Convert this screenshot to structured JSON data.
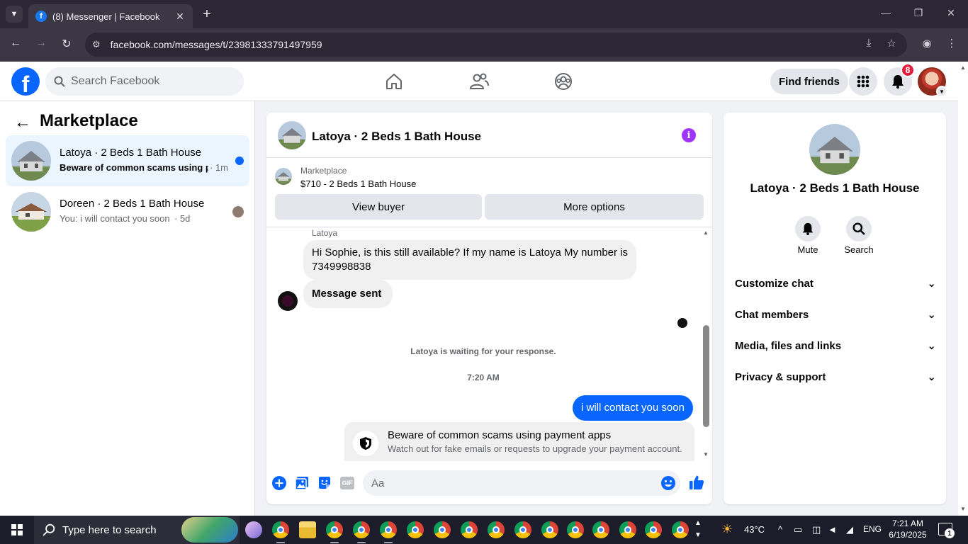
{
  "browser": {
    "tab_title": "(8) Messenger | Facebook",
    "url": "facebook.com/messages/t/23981333791497959"
  },
  "header": {
    "search_placeholder": "Search Facebook",
    "find_friends": "Find friends",
    "notification_count": "8",
    "brand_color": "#0866ff"
  },
  "sidebar": {
    "title": "Marketplace",
    "conversations": [
      {
        "name": "Latoya · 2 Beds 1 Bath House",
        "snippet": "Beware of common scams using p...",
        "time": "· 1m",
        "unread": true
      },
      {
        "name": "Doreen · 2 Beds 1 Bath House",
        "snippet": "You: i will contact you soon",
        "time": "· 5d",
        "unread": false
      }
    ]
  },
  "chat": {
    "title": "Latoya · 2 Beds 1 Bath House",
    "marketplace_label": "Marketplace",
    "listing": "$710 - 2 Beds 1 Bath House",
    "view_buyer": "View buyer",
    "more_options": "More options",
    "sender_name": "Latoya",
    "messages_in": [
      "Hi Sophie, is this still available? If my name is Latoya My number is 7349998838",
      "Message sent"
    ],
    "waiting": "Latoya is waiting for your response.",
    "timestamp": "7:20 AM",
    "message_out": "i will contact you soon",
    "scam_title": "Beware of common scams using payment apps",
    "scam_text": "Watch out for fake emails or requests to upgrade your payment account.",
    "composer_placeholder": "Aa",
    "gif_label": "GIF"
  },
  "info_panel": {
    "name": "Latoya · 2 Beds 1 Bath House",
    "mute": "Mute",
    "search": "Search",
    "sections": [
      "Customize chat",
      "Chat members",
      "Media, files and links",
      "Privacy & support"
    ]
  },
  "taskbar": {
    "search_placeholder": "Type here to search",
    "temperature": "43°C",
    "language": "ENG",
    "time": "7:21 AM",
    "date": "6/19/2025",
    "notifications": "1"
  }
}
